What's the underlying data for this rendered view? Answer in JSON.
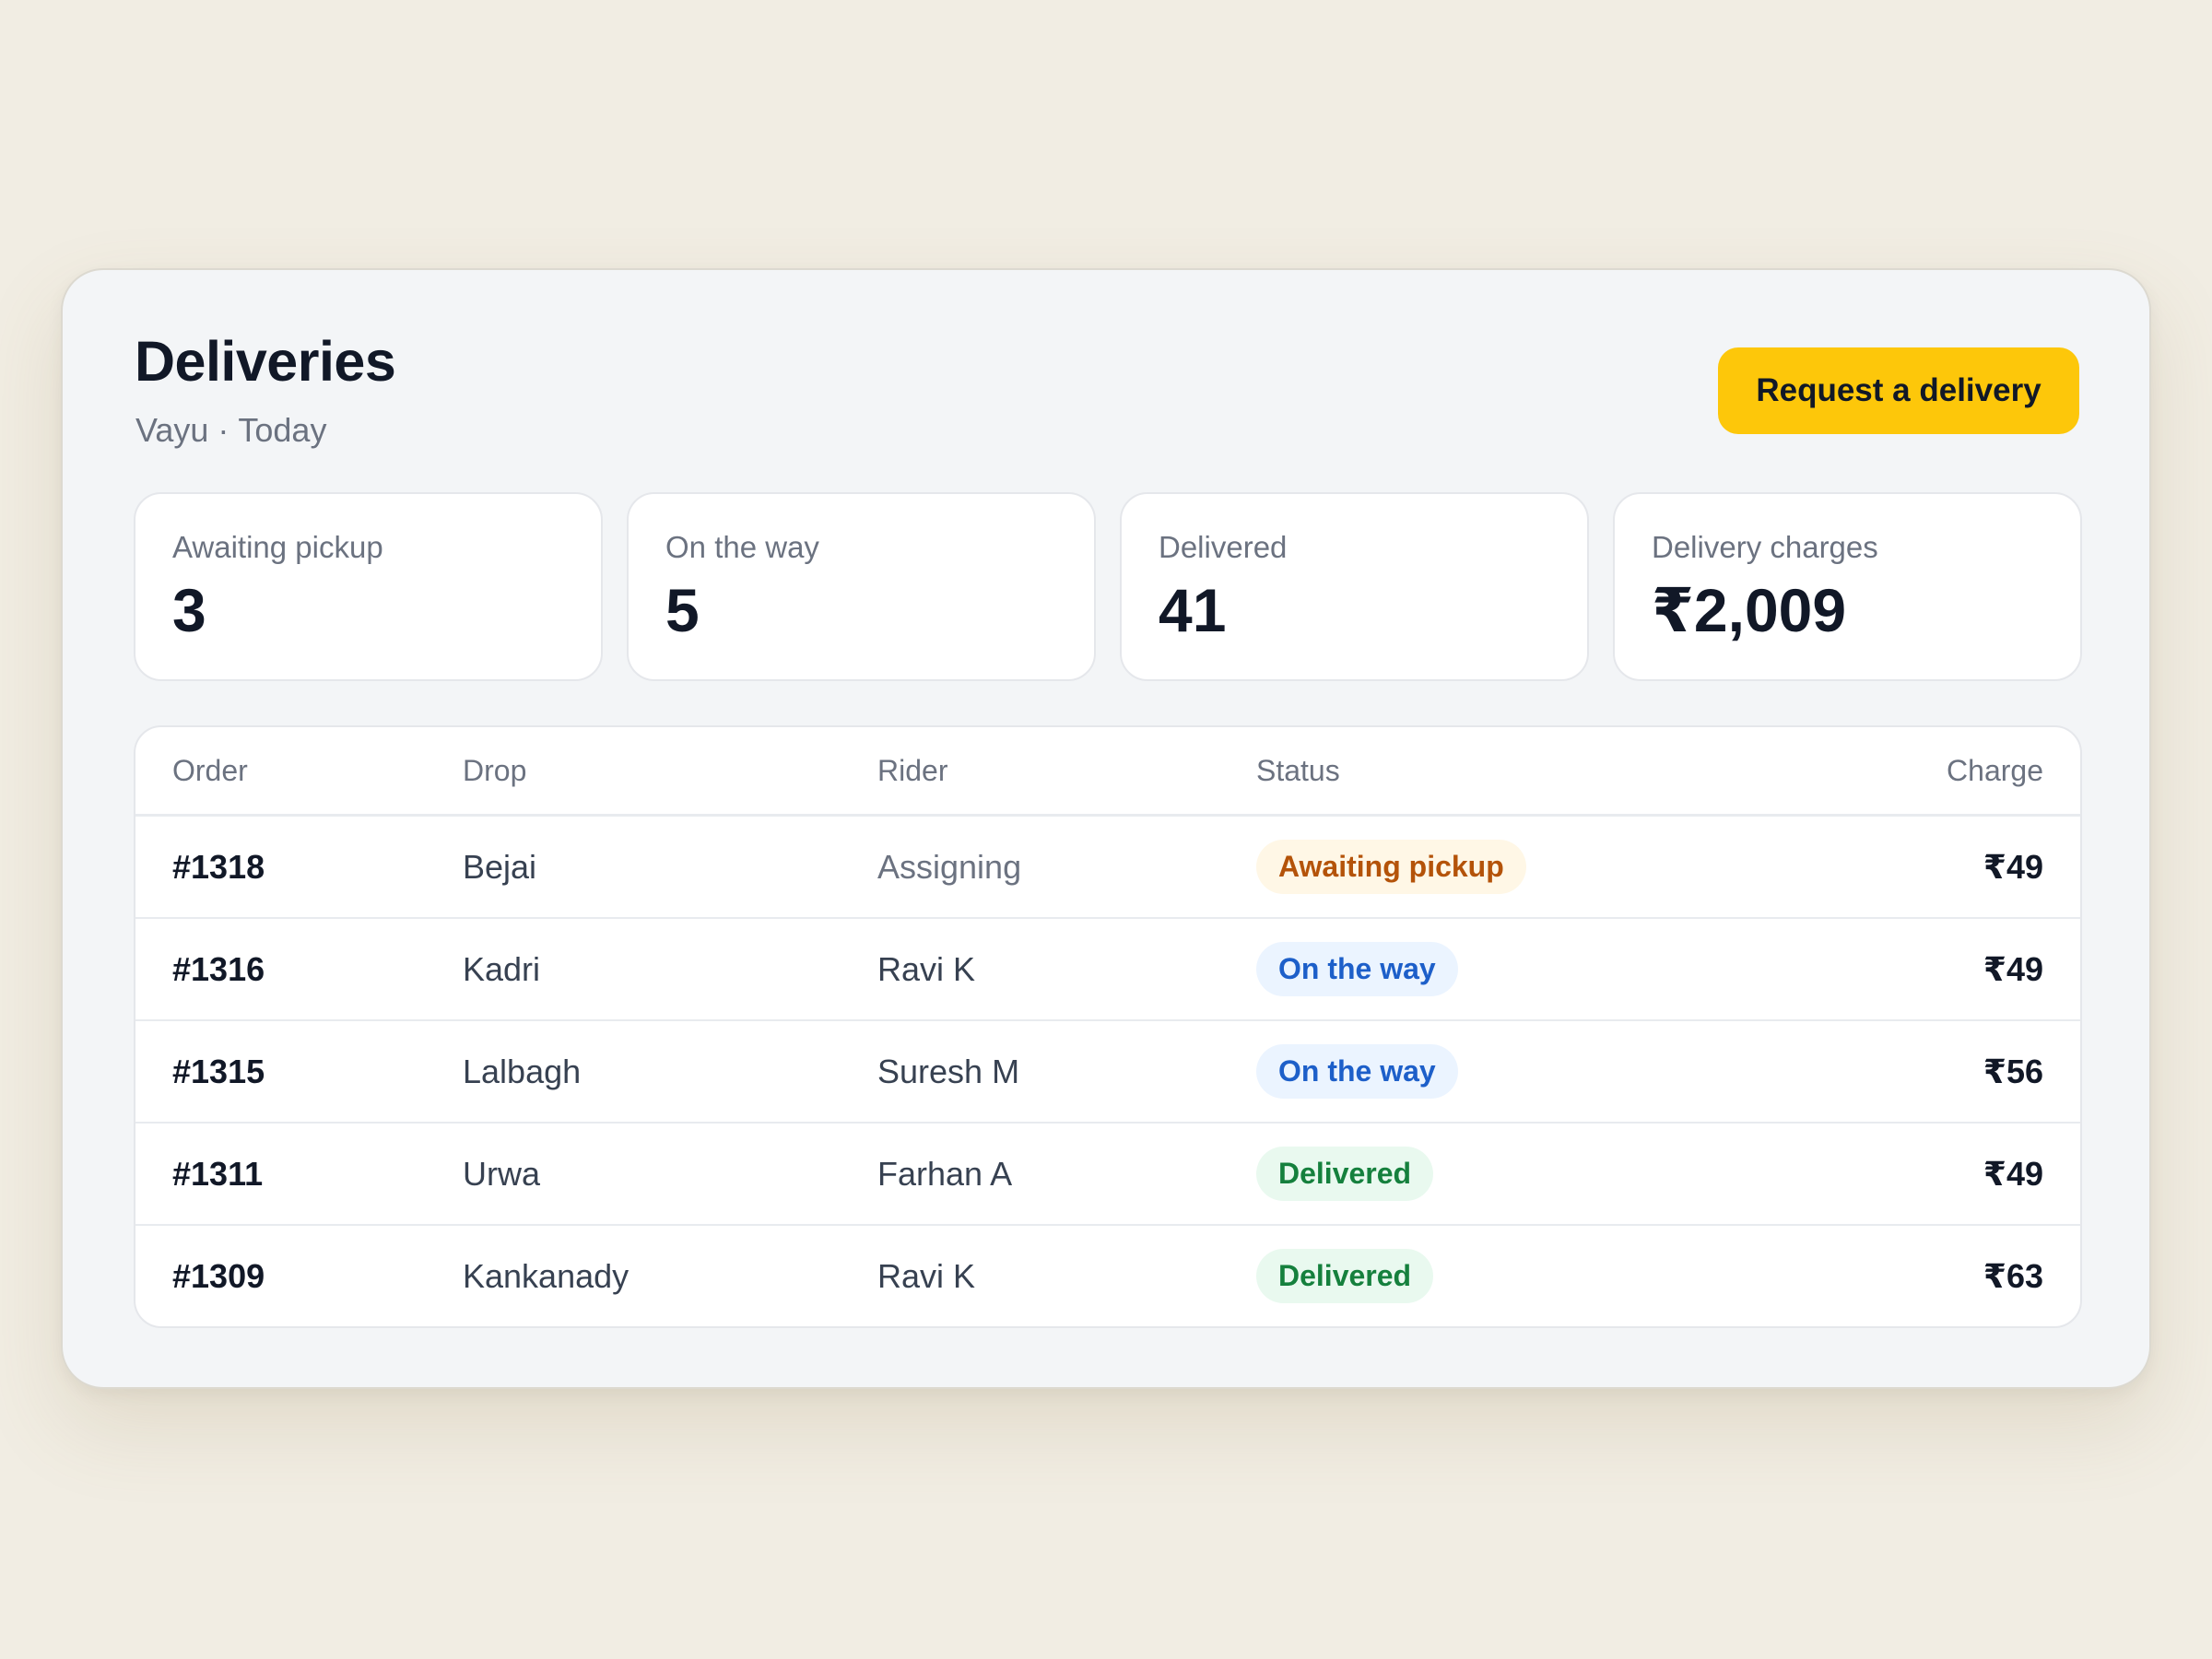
{
  "header": {
    "title": "Deliveries",
    "account": "Vayu",
    "separator": "·",
    "period": "Today",
    "cta_label": "Request a delivery"
  },
  "stats": [
    {
      "label": "Awaiting pickup",
      "value": "3"
    },
    {
      "label": "On the way",
      "value": "5"
    },
    {
      "label": "Delivered",
      "value": "41"
    },
    {
      "label": "Delivery charges",
      "value": "₹2,009"
    }
  ],
  "table": {
    "columns": {
      "order": "Order",
      "drop": "Drop",
      "rider": "Rider",
      "status": "Status",
      "charge": "Charge"
    },
    "rows": [
      {
        "order": "#1318",
        "drop": "Bejai",
        "rider": "Assigning",
        "status": "Awaiting pickup",
        "charge": "₹49"
      },
      {
        "order": "#1316",
        "drop": "Kadri",
        "rider": "Ravi K",
        "status": "On the way",
        "charge": "₹49"
      },
      {
        "order": "#1315",
        "drop": "Lalbagh",
        "rider": "Suresh M",
        "status": "On the way",
        "charge": "₹56"
      },
      {
        "order": "#1311",
        "drop": "Urwa",
        "rider": "Farhan A",
        "status": "Delivered",
        "charge": "₹49"
      },
      {
        "order": "#1309",
        "drop": "Kankanady",
        "rider": "Ravi K",
        "status": "Delivered",
        "charge": "₹63"
      }
    ]
  },
  "colors": {
    "background": "#f1ede3",
    "panel": "#f3f5f7",
    "accent": "#fdc70a",
    "awaiting": "#b45309",
    "on_the_way": "#1d5fc9",
    "delivered": "#15803d"
  }
}
